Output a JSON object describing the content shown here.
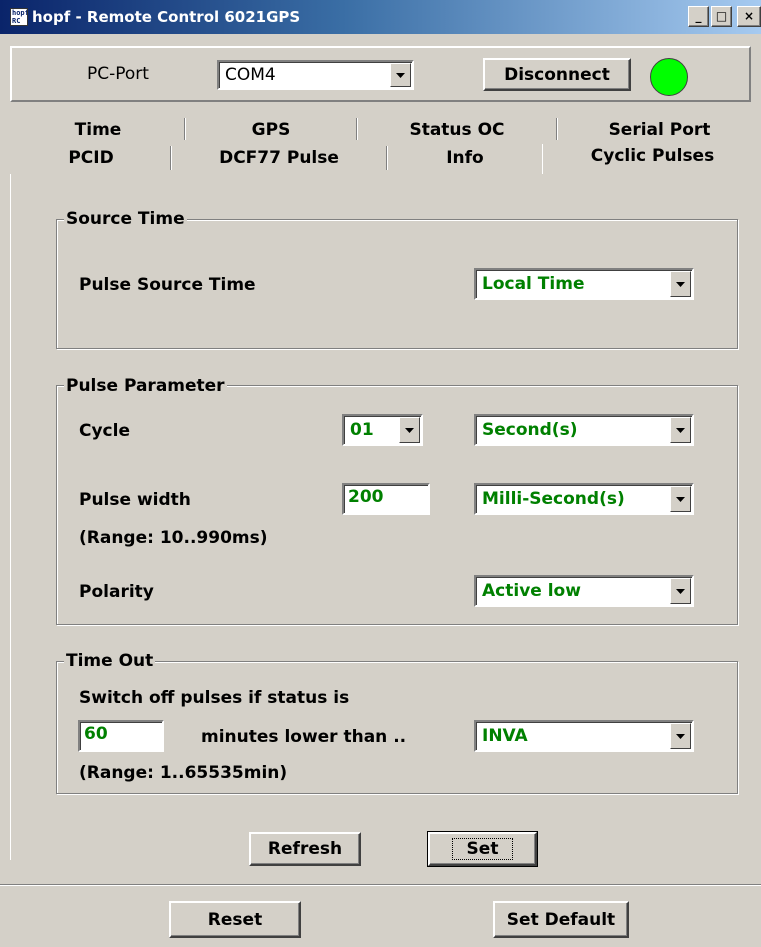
{
  "window": {
    "title": "hopf - Remote Control 6021GPS",
    "icon_text": "hopf RC",
    "buttons": {
      "minimize": "_",
      "maximize": "□",
      "close": "×"
    }
  },
  "top_panel": {
    "port_label": "PC-Port",
    "port_value": "COM4",
    "disconnect_label": "Disconnect",
    "status_color": "#00ff00"
  },
  "tabs": {
    "row1": [
      "Time",
      "GPS",
      "Status OC",
      "Serial Port"
    ],
    "row2": [
      "PCID",
      "DCF77 Pulse",
      "Info",
      "Cyclic Pulses"
    ],
    "active": "Cyclic Pulses"
  },
  "source_time": {
    "title": "Source Time",
    "pulse_source_label": "Pulse Source Time",
    "pulse_source_value": "Local Time"
  },
  "pulse_parameter": {
    "title": "Pulse Parameter",
    "cycle_label": "Cycle",
    "cycle_value": "01",
    "cycle_unit": "Second(s)",
    "width_label": "Pulse width",
    "width_value": "200",
    "width_unit": "Milli-Second(s)",
    "width_range": "(Range: 10..990ms)",
    "polarity_label": "Polarity",
    "polarity_value": "Active low"
  },
  "time_out": {
    "title": "Time Out",
    "description": "Switch off pulses if status is",
    "minutes_value": "60",
    "minutes_label": "minutes lower than ..",
    "status_value": "INVA",
    "range": "(Range: 1..65535min)"
  },
  "actions": {
    "refresh_label": "Refresh",
    "set_label": "Set",
    "reset_label": "Reset",
    "set_default_label": "Set Default"
  },
  "colors": {
    "value_green": "#008000",
    "titlebar_start": "#0a246a",
    "face": "#d4d0c8"
  }
}
